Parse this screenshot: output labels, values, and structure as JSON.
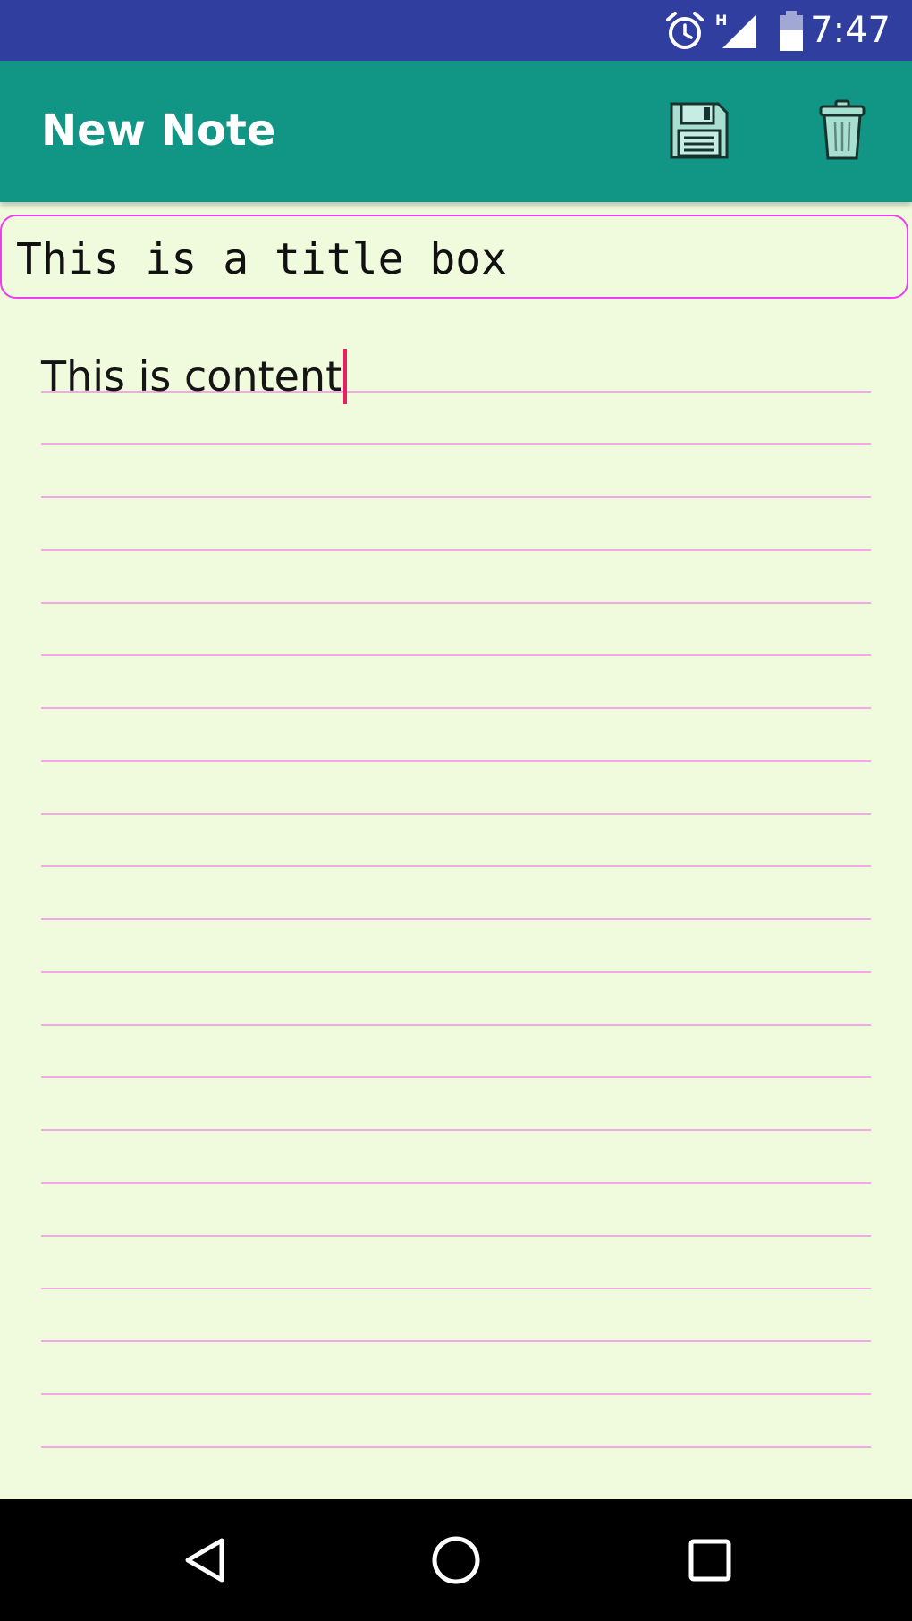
{
  "status_bar": {
    "time": "7:47",
    "network_label": "H",
    "icons": [
      "alarm-icon",
      "signal-icon",
      "battery-icon"
    ],
    "background": "#303f9f"
  },
  "app_bar": {
    "title": "New Note",
    "background": "#119584",
    "actions": [
      "save-icon",
      "delete-icon"
    ]
  },
  "note": {
    "title_value": "This is a title box",
    "content_value": "This is content",
    "title_border_color": "#f13bf1",
    "rule_color": "#f4a8e6",
    "caret_color": "#e91e63",
    "background": "#f0fbde"
  },
  "nav_bar": {
    "buttons": [
      "back-icon",
      "home-icon",
      "recent-apps-icon"
    ]
  }
}
